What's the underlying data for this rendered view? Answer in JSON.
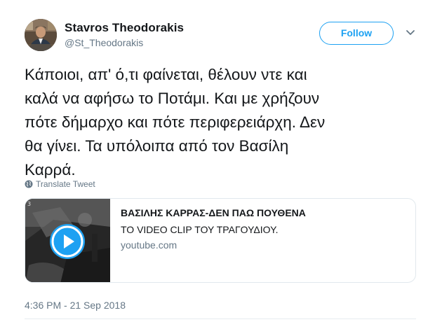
{
  "user": {
    "name": "Stavros Theodorakis",
    "handle": "@St_Theodorakis",
    "follow_label": "Follow"
  },
  "tweet": {
    "text": "Κάποιοι, απ' ό,τι φαίνεται, θέλουν ντε και καλά να αφήσω το Ποτάμι. Και με χρήζουν πότε δήμαρχο και πότε περιφερειάρχη. Δεν θα γίνει. Τα υπόλοιπα από τον Βασίλη Καρρά.",
    "text_lines": [
      "Κάποιοι, απ' ό,τι φαίνεται, θέλουν ντε και",
      "καλά να αφήσω το Ποτάμι. Και με χρήζουν",
      "πότε δήμαρχο και πότε περιφερειάρχη. Δεν",
      "θα γίνει. Τα υπόλοιπα από τον Βασίλη",
      "Καρρά."
    ],
    "translate_label": "Translate Tweet",
    "timestamp": "4:36 PM - 21 Sep 2018"
  },
  "card": {
    "title": "ΒΑΣΙΛΗΣ ΚΑΡΡΑΣ-ΔΕΝ ΠΑΩ ΠΟΥΘΕΝΑ",
    "description": "ΤΟ VIDEO CLIP ΤΟΥ ΤΡΑΓΟΥΔΙΟΥ.",
    "domain": "youtube.com",
    "thumb_number": "3"
  },
  "icons": {
    "avatar": "avatar-photo",
    "caret": "chevron-down-icon",
    "translate": "globe-icon",
    "play": "play-icon"
  },
  "colors": {
    "accent": "#1da1f2",
    "text": "#14171a",
    "muted": "#657786",
    "border": "#e1e8ed"
  }
}
